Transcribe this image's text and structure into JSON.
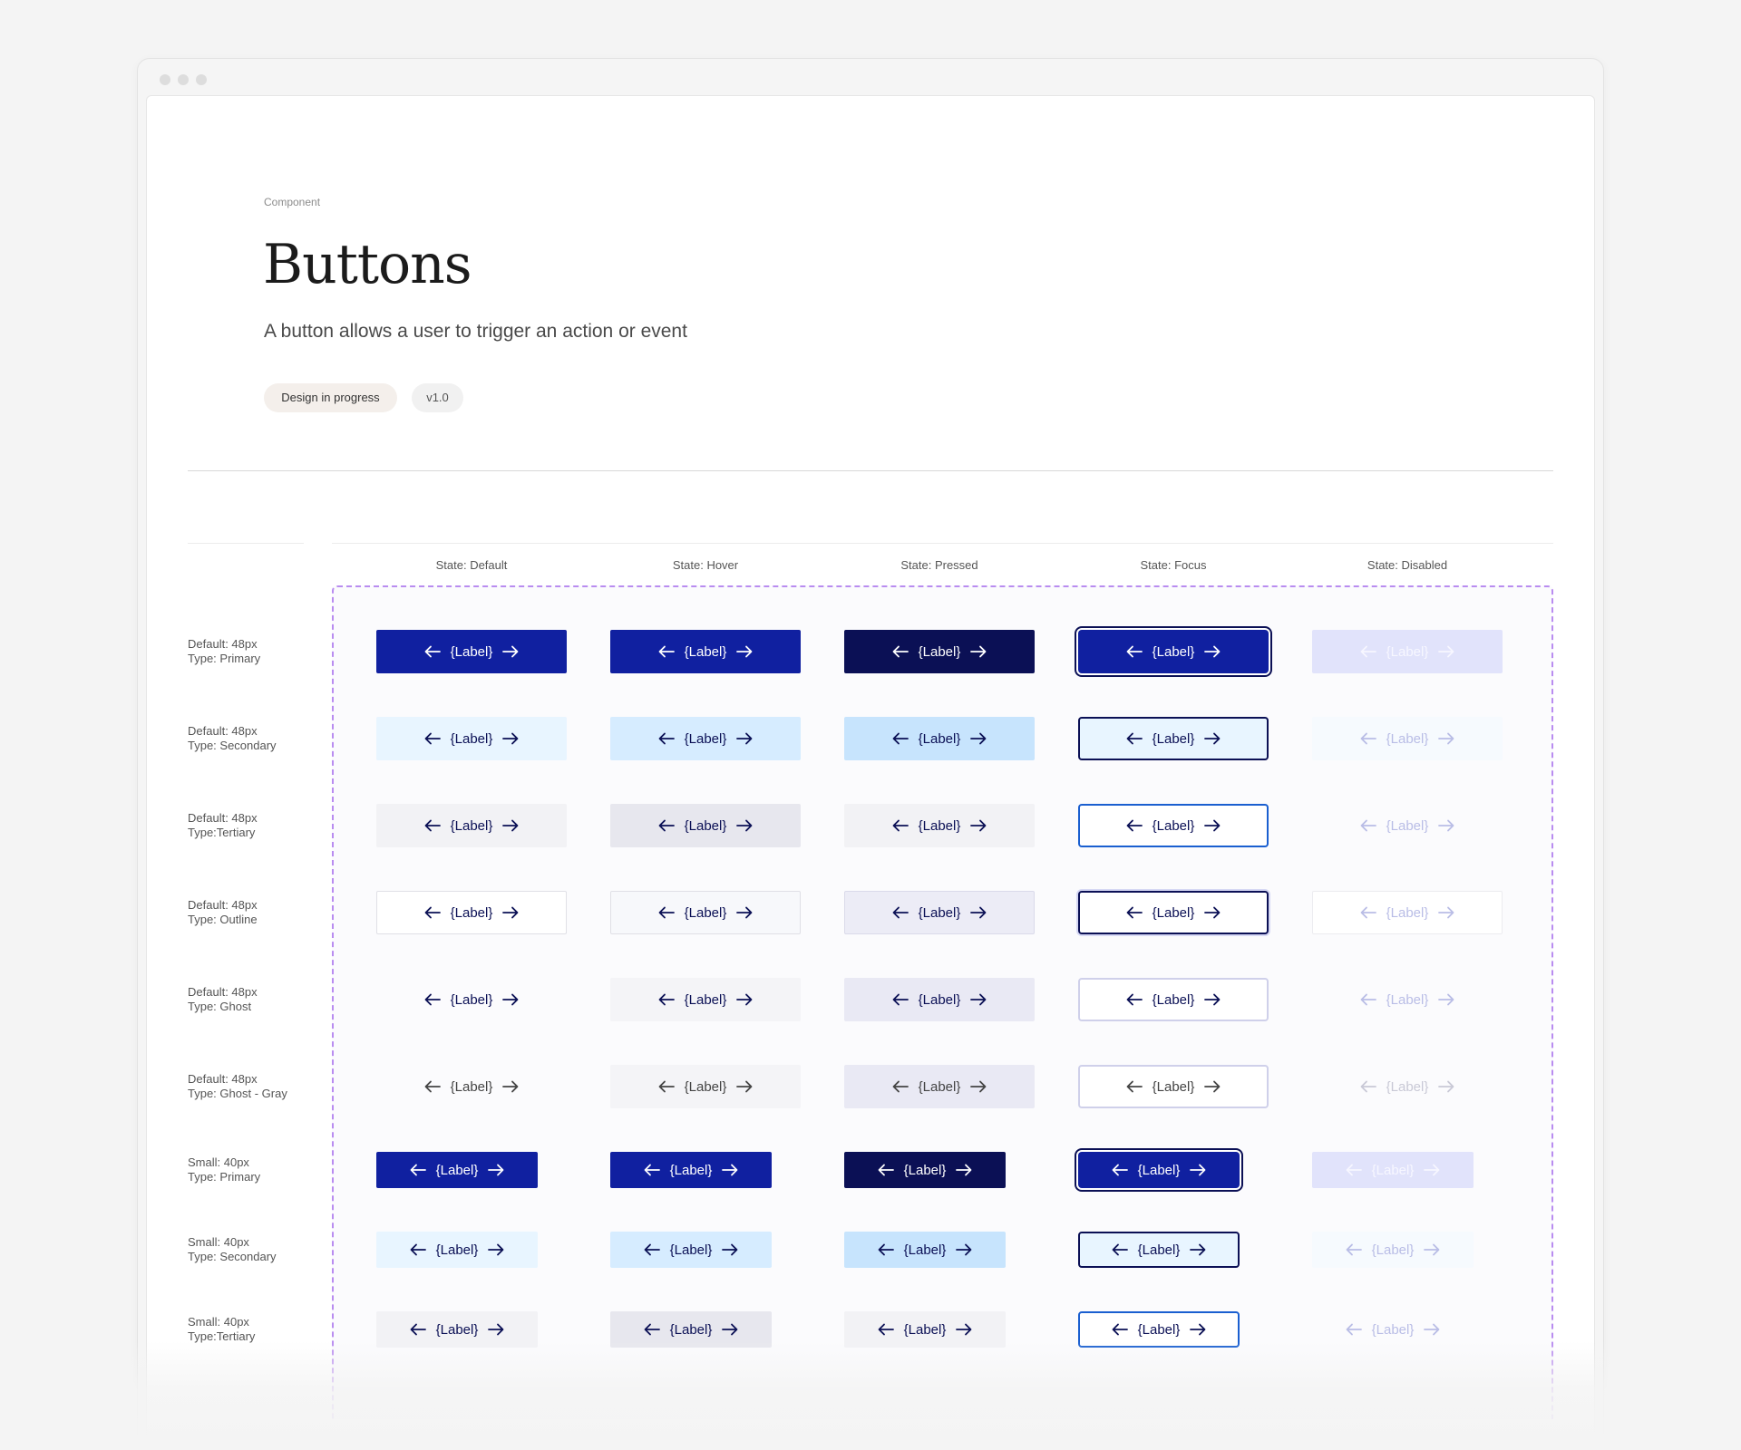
{
  "page": {
    "eyebrow": "Component",
    "title": "Buttons",
    "subtitle": "A button allows a user to trigger an action or event",
    "status_pill": "Design in progress",
    "version_pill": "v1.0"
  },
  "columns": [
    "State: Default",
    "State: Hover",
    "State: Pressed",
    "State: Focus",
    "State: Disabled"
  ],
  "button_label": "{Label}",
  "icons": {
    "leading": "arrow-left-icon",
    "trailing": "arrow-right-icon"
  },
  "rows": [
    {
      "size": "Default: 48px",
      "type": "Type: Primary"
    },
    {
      "size": "Default: 48px",
      "type": "Type: Secondary"
    },
    {
      "size": "Default: 48px",
      "type": "Type:Tertiary"
    },
    {
      "size": "Default: 48px",
      "type": "Type: Outline"
    },
    {
      "size": "Default: 48px",
      "type": "Type: Ghost"
    },
    {
      "size": "Default: 48px",
      "type": "Type: Ghost - Gray"
    },
    {
      "size": "Small: 40px",
      "type": "Type: Primary"
    },
    {
      "size": "Small: 40px",
      "type": "Type: Secondary"
    },
    {
      "size": "Small: 40px",
      "type": "Type:Tertiary"
    }
  ],
  "colors": {
    "primary": "#1020a0",
    "primary_pressed": "#0b1055",
    "primary_disabled": "#e1e3fb",
    "secondary": "#e8f5ff",
    "secondary_hover": "#d6ecff",
    "secondary_pressed": "#c7e4fd",
    "tertiary": "#f2f2f5",
    "tertiary_hover": "#e7e7ee",
    "focus_ring": "#0b1055",
    "focus_blue": "#1a5fd0",
    "text_dark": "#0b1055",
    "text_disabled": "#b9bde6",
    "dashed_border": "#b98cf0"
  }
}
